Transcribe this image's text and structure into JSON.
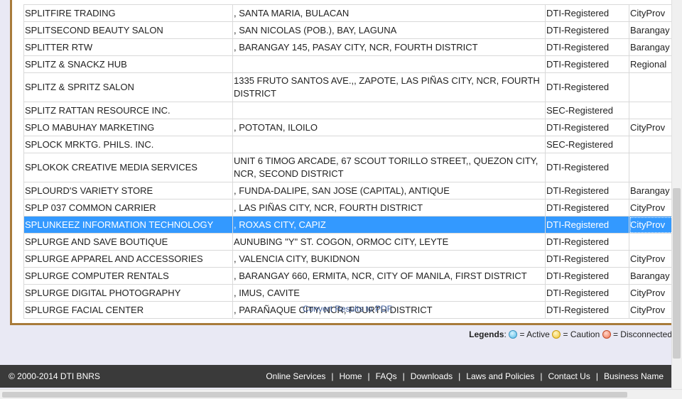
{
  "rows": [
    {
      "name": "SPLITFIRE TRADING",
      "address": ", SANTA MARIA, BULACAN",
      "status": "DTI-Registered",
      "scope": "CityProv"
    },
    {
      "name": "SPLITSECOND BEAUTY SALON",
      "address": ", SAN NICOLAS (POB.), BAY, LAGUNA",
      "status": "DTI-Registered",
      "scope": "Barangay"
    },
    {
      "name": "SPLITTER RTW",
      "address": ", BARANGAY 145, PASAY CITY, NCR, FOURTH DISTRICT",
      "status": "DTI-Registered",
      "scope": "Barangay"
    },
    {
      "name": "SPLITZ & SNACKZ HUB",
      "address": "",
      "status": "DTI-Registered",
      "scope": "Regional"
    },
    {
      "name": "SPLITZ & SPRITZ SALON",
      "address": "1335 FRUTO SANTOS AVE.,, ZAPOTE, LAS PIÑAS CITY, NCR, FOURTH DISTRICT",
      "status": "DTI-Registered",
      "scope": ""
    },
    {
      "name": "SPLITZ RATTAN RESOURCE INC.",
      "address": "",
      "status": "SEC-Registered",
      "scope": ""
    },
    {
      "name": "SPLO MABUHAY MARKETING",
      "address": ", POTOTAN, ILOILO",
      "status": "DTI-Registered",
      "scope": "CityProv"
    },
    {
      "name": "SPLOCK MRKTG. PHILS. INC.",
      "address": "",
      "status": "SEC-Registered",
      "scope": ""
    },
    {
      "name": "SPLOKOK CREATIVE MEDIA SERVICES",
      "address": "UNIT 6 TIMOG ARCADE, 67 SCOUT TORILLO STREET,, QUEZON CITY, NCR, SECOND DISTRICT",
      "status": "DTI-Registered",
      "scope": ""
    },
    {
      "name": "SPLOURD'S VARIETY STORE",
      "address": ", FUNDA-DALIPE, SAN JOSE (CAPITAL), ANTIQUE",
      "status": "DTI-Registered",
      "scope": "Barangay"
    },
    {
      "name": "SPLP 037 COMMON CARRIER",
      "address": ", LAS PIÑAS CITY, NCR, FOURTH DISTRICT",
      "status": "DTI-Registered",
      "scope": "CityProv"
    },
    {
      "name": "SPLUNKEEZ INFORMATION TECHNOLOGY",
      "address": ", ROXAS CITY, CAPIZ",
      "status": "DTI-Registered",
      "scope": "CityProv"
    },
    {
      "name": "SPLURGE AND SAVE BOUTIQUE",
      "address": "AUNUBING \"Y\" ST. COGON, ORMOC CITY, LEYTE",
      "status": "DTI-Registered",
      "scope": ""
    },
    {
      "name": "SPLURGE APPAREL AND ACCESSORIES",
      "address": ", VALENCIA CITY, BUKIDNON",
      "status": "DTI-Registered",
      "scope": "CityProv"
    },
    {
      "name": "SPLURGE COMPUTER RENTALS",
      "address": ", BARANGAY 660, ERMITA, NCR, CITY OF MANILA, FIRST DISTRICT",
      "status": "DTI-Registered",
      "scope": "Barangay"
    },
    {
      "name": "SPLURGE DIGITAL PHOTOGRAPHY",
      "address": ", IMUS, CAVITE",
      "status": "DTI-Registered",
      "scope": "CityProv"
    },
    {
      "name": "SPLURGE FACIAL CENTER",
      "address": ", PARAÑAQUE CITY, NCR, FOURTH DISTRICT",
      "status": "DTI-Registered",
      "scope": "CityProv"
    }
  ],
  "convert_link": "Convert Results to PDF.",
  "legends": {
    "label": "Legends",
    "active": "= Active",
    "caution": "= Caution",
    "disconnected": "= Disconnected"
  },
  "footer": {
    "copyright": "© 2000-2014 DTI BNRS",
    "nav": [
      "Online Services",
      "Home",
      "FAQs",
      "Downloads",
      "Laws and Policies",
      "Contact Us",
      "Business Name"
    ]
  }
}
